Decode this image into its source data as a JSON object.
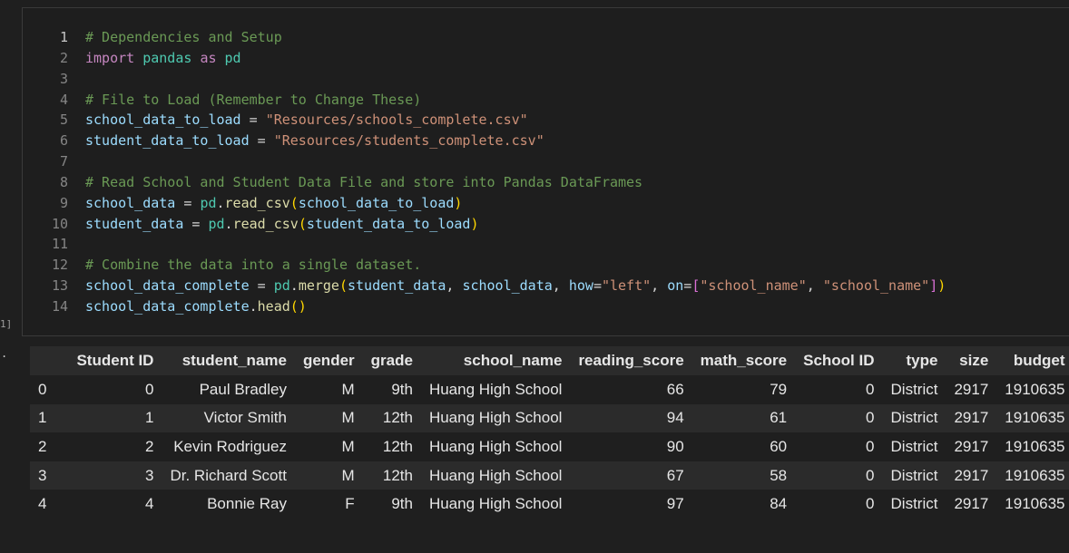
{
  "cell": {
    "execution_count": "1]",
    "out_marker": ".",
    "code_lines": [
      {
        "n": "1",
        "tokens": [
          {
            "t": "# Dependencies and Setup",
            "c": "tk-comment"
          }
        ]
      },
      {
        "n": "2",
        "tokens": [
          {
            "t": "import",
            "c": "tk-kw"
          },
          {
            "t": " ",
            "c": "tk-op"
          },
          {
            "t": "pandas",
            "c": "tk-mod"
          },
          {
            "t": " ",
            "c": "tk-op"
          },
          {
            "t": "as",
            "c": "tk-kw"
          },
          {
            "t": " ",
            "c": "tk-op"
          },
          {
            "t": "pd",
            "c": "tk-mod"
          }
        ]
      },
      {
        "n": "3",
        "tokens": []
      },
      {
        "n": "4",
        "tokens": [
          {
            "t": "# File to Load (Remember to Change These)",
            "c": "tk-comment"
          }
        ]
      },
      {
        "n": "5",
        "tokens": [
          {
            "t": "school_data_to_load",
            "c": "tk-var"
          },
          {
            "t": " = ",
            "c": "tk-op"
          },
          {
            "t": "\"Resources/schools_complete.csv\"",
            "c": "tk-str"
          }
        ]
      },
      {
        "n": "6",
        "tokens": [
          {
            "t": "student_data_to_load",
            "c": "tk-var"
          },
          {
            "t": " = ",
            "c": "tk-op"
          },
          {
            "t": "\"Resources/students_complete.csv\"",
            "c": "tk-str"
          }
        ]
      },
      {
        "n": "7",
        "tokens": []
      },
      {
        "n": "8",
        "tokens": [
          {
            "t": "# Read School and Student Data File and store into Pandas DataFrames",
            "c": "tk-comment"
          }
        ]
      },
      {
        "n": "9",
        "tokens": [
          {
            "t": "school_data",
            "c": "tk-var"
          },
          {
            "t": " = ",
            "c": "tk-op"
          },
          {
            "t": "pd",
            "c": "tk-mod"
          },
          {
            "t": ".",
            "c": "tk-op"
          },
          {
            "t": "read_csv",
            "c": "tk-fn"
          },
          {
            "t": "(",
            "c": "tk-p1"
          },
          {
            "t": "school_data_to_load",
            "c": "tk-var"
          },
          {
            "t": ")",
            "c": "tk-p1"
          }
        ]
      },
      {
        "n": "10",
        "tokens": [
          {
            "t": "student_data",
            "c": "tk-var"
          },
          {
            "t": " = ",
            "c": "tk-op"
          },
          {
            "t": "pd",
            "c": "tk-mod"
          },
          {
            "t": ".",
            "c": "tk-op"
          },
          {
            "t": "read_csv",
            "c": "tk-fn"
          },
          {
            "t": "(",
            "c": "tk-p1"
          },
          {
            "t": "student_data_to_load",
            "c": "tk-var"
          },
          {
            "t": ")",
            "c": "tk-p1"
          }
        ]
      },
      {
        "n": "11",
        "tokens": []
      },
      {
        "n": "12",
        "tokens": [
          {
            "t": "# Combine the data into a single dataset.",
            "c": "tk-comment"
          }
        ]
      },
      {
        "n": "13",
        "tokens": [
          {
            "t": "school_data_complete",
            "c": "tk-var"
          },
          {
            "t": " = ",
            "c": "tk-op"
          },
          {
            "t": "pd",
            "c": "tk-mod"
          },
          {
            "t": ".",
            "c": "tk-op"
          },
          {
            "t": "merge",
            "c": "tk-fn"
          },
          {
            "t": "(",
            "c": "tk-p1"
          },
          {
            "t": "student_data",
            "c": "tk-var"
          },
          {
            "t": ", ",
            "c": "tk-op"
          },
          {
            "t": "school_data",
            "c": "tk-var"
          },
          {
            "t": ", ",
            "c": "tk-op"
          },
          {
            "t": "how",
            "c": "tk-var"
          },
          {
            "t": "=",
            "c": "tk-op"
          },
          {
            "t": "\"left\"",
            "c": "tk-str"
          },
          {
            "t": ", ",
            "c": "tk-op"
          },
          {
            "t": "on",
            "c": "tk-var"
          },
          {
            "t": "=",
            "c": "tk-op"
          },
          {
            "t": "[",
            "c": "tk-p2"
          },
          {
            "t": "\"school_name\"",
            "c": "tk-str"
          },
          {
            "t": ", ",
            "c": "tk-op"
          },
          {
            "t": "\"school_name\"",
            "c": "tk-str"
          },
          {
            "t": "]",
            "c": "tk-p2"
          },
          {
            "t": ")",
            "c": "tk-p1"
          }
        ]
      },
      {
        "n": "14",
        "tokens": [
          {
            "t": "school_data_complete",
            "c": "tk-var"
          },
          {
            "t": ".",
            "c": "tk-op"
          },
          {
            "t": "head",
            "c": "tk-fn"
          },
          {
            "t": "()",
            "c": "tk-p1"
          }
        ]
      }
    ]
  },
  "output_table": {
    "index_header": "",
    "columns": [
      "Student ID",
      "student_name",
      "gender",
      "grade",
      "school_name",
      "reading_score",
      "math_score",
      "School ID",
      "type",
      "size",
      "budget"
    ],
    "rows": [
      {
        "index": "0",
        "cells": [
          "0",
          "Paul Bradley",
          "M",
          "9th",
          "Huang High School",
          "66",
          "79",
          "0",
          "District",
          "2917",
          "1910635"
        ]
      },
      {
        "index": "1",
        "cells": [
          "1",
          "Victor Smith",
          "M",
          "12th",
          "Huang High School",
          "94",
          "61",
          "0",
          "District",
          "2917",
          "1910635"
        ]
      },
      {
        "index": "2",
        "cells": [
          "2",
          "Kevin Rodriguez",
          "M",
          "12th",
          "Huang High School",
          "90",
          "60",
          "0",
          "District",
          "2917",
          "1910635"
        ]
      },
      {
        "index": "3",
        "cells": [
          "3",
          "Dr. Richard Scott",
          "M",
          "12th",
          "Huang High School",
          "67",
          "58",
          "0",
          "District",
          "2917",
          "1910635"
        ]
      },
      {
        "index": "4",
        "cells": [
          "4",
          "Bonnie Ray",
          "F",
          "9th",
          "Huang High School",
          "97",
          "84",
          "0",
          "District",
          "2917",
          "1910635"
        ]
      }
    ]
  }
}
